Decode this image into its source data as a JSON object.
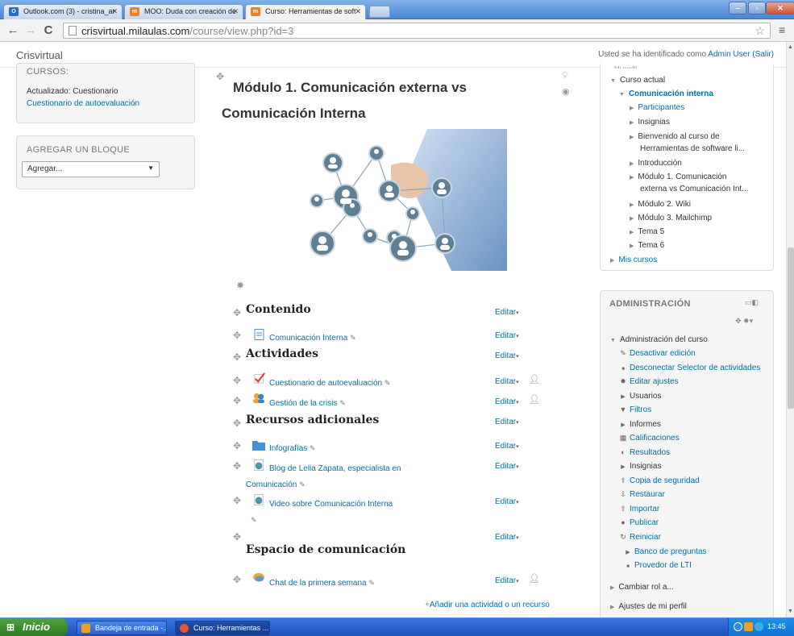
{
  "browser": {
    "tabs": [
      {
        "label": "Outlook.com (3) - cristina_ar",
        "icon": "outlook-icon",
        "color": "#2a6ac9"
      },
      {
        "label": "MOO: Duda con creación de",
        "icon": "moodle-icon",
        "color": "#f07f1d"
      },
      {
        "label": "Curso: Herramientas de soft",
        "icon": "moodle-icon",
        "color": "#f07f1d"
      }
    ],
    "url_host": "crisvirtual.milaulas.com",
    "url_path": "/course/view.php?id=3"
  },
  "header": {
    "site_name": "Crisvirtual",
    "login_prefix": "Usted se ha identificado como ",
    "user": "Admin User",
    "logout": "(Salir)"
  },
  "left": {
    "block1_title": "CURSOS:",
    "updated": "Actualizado: Cuestionario",
    "quiz_link": "Cuestionario de autoevaluación",
    "block2_title": "AGREGAR UN BLOQUE",
    "add_select": "Agregar..."
  },
  "main": {
    "topic_title_1": "Módulo 1. Comunicación externa vs",
    "topic_title_2": "Comunicación Interna",
    "edit_label": "Editar",
    "sections": {
      "contenido": "Contenido",
      "actividades": "Actividades",
      "recursos": "Recursos adicionales",
      "espacio": "Espacio de comunicación"
    },
    "items": {
      "com_interna": "Comunicación Interna",
      "cuestionario": "Cuestionario de autoevaluación",
      "gestion": "Gestión de la crisis",
      "infografias": "Infografías",
      "blog_1": "Blog de Lelia Zapata, especialista en",
      "blog_2": "Comunicación",
      "video": "Video sobre Comunicación Interna",
      "chat": "Chat de la primera semana"
    },
    "add_activity": "Añadir una actividad o un recurso"
  },
  "nav": {
    "top_cut": "Mi perfil",
    "curso_actual": "Curso actual",
    "course": "Comunicación interna",
    "items": [
      "Participantes",
      "Insignias",
      "Bienvenido al curso de",
      "Herramientas de software li...",
      "Introducción",
      "Módulo 1. Comunicación",
      "externa vs Comunicación Int...",
      "Módulo 2. Wiki",
      "Módulo 3. Mailchimp",
      "Tema 5",
      "Tema 6"
    ],
    "mis_cursos": "Mis cursos"
  },
  "admin": {
    "title": "ADMINISTRACIÓN",
    "curso": "Administración del curso",
    "items": [
      {
        "label": "Desactivar edición",
        "icon": "pencil-icon",
        "link": true
      },
      {
        "label": "Desconectar Selector de actividades",
        "icon": "bullet-icon",
        "link": true
      },
      {
        "label": "Editar ajustes",
        "icon": "gear-icon",
        "link": true
      },
      {
        "label": "Usuarios",
        "icon": "triangle-icon",
        "link": false
      },
      {
        "label": "Filtros",
        "icon": "filter-icon",
        "link": true
      },
      {
        "label": "Informes",
        "icon": "triangle-icon",
        "link": false
      },
      {
        "label": "Calificaciones",
        "icon": "grades-icon",
        "link": true
      },
      {
        "label": "Resultados",
        "icon": "outcomes-icon",
        "link": true
      },
      {
        "label": "Insignias",
        "icon": "triangle-icon",
        "link": false
      },
      {
        "label": "Copia de seguridad",
        "icon": "backup-icon",
        "link": true
      },
      {
        "label": "Restaurar",
        "icon": "restore-icon",
        "link": true
      },
      {
        "label": "Importar",
        "icon": "import-icon",
        "link": true
      },
      {
        "label": "Publicar",
        "icon": "publish-icon",
        "link": true
      },
      {
        "label": "Reiniciar",
        "icon": "reset-icon",
        "link": true
      },
      {
        "label": "Banco de preguntas",
        "icon": "triangle-icon",
        "link": true
      },
      {
        "label": "Provedor de LTI",
        "icon": "bullet-icon",
        "link": true
      }
    ],
    "cambiar_rol": "Cambiar rol a...",
    "ajustes": "Ajustes de mi perfil"
  },
  "taskbar": {
    "start": "Inicio",
    "tasks": [
      "Bandeja de entrada -...",
      "Curso: Herramientas ..."
    ],
    "clock": "13:45"
  }
}
